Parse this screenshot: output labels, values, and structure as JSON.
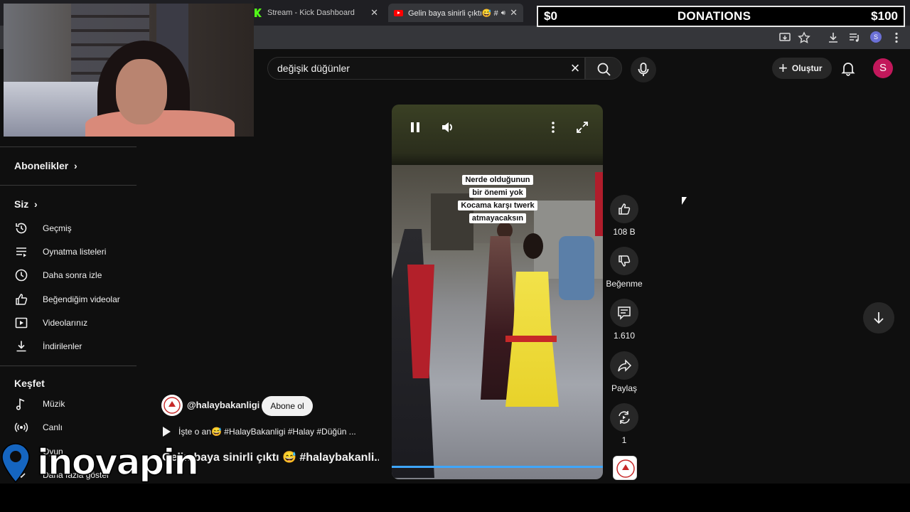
{
  "browser": {
    "tabs": [
      {
        "title": "Stream - Kick Dashboard",
        "icon": "kick-icon",
        "close": "✕"
      },
      {
        "title": "Gelin baya sinirli çıktı😅 #h",
        "icon": "youtube-icon",
        "close": "✕"
      }
    ]
  },
  "overlay": {
    "donations_left": "$0",
    "donations_label": "DONATIONS",
    "donations_right": "$100"
  },
  "header": {
    "search_value": "değişik düğünler",
    "create_label": "Oluştur",
    "avatar_letter": "S"
  },
  "sidebar": {
    "subscriptions_label": "Abonelikler",
    "you_label": "Siz",
    "you_items": [
      {
        "label": "Geçmiş",
        "icon": "history-icon"
      },
      {
        "label": "Oynatma listeleri",
        "icon": "playlist-icon"
      },
      {
        "label": "Daha sonra izle",
        "icon": "clock-icon"
      },
      {
        "label": "Beğendiğim videolar",
        "icon": "thumb-up-icon"
      },
      {
        "label": "Videolarınız",
        "icon": "video-icon"
      },
      {
        "label": "İndirilenler",
        "icon": "download-icon"
      }
    ],
    "explore_label": "Keşfet",
    "explore_items": [
      {
        "label": "Müzik",
        "icon": "music-note-icon"
      },
      {
        "label": "Canlı",
        "icon": "live-icon"
      },
      {
        "label": "Oyun",
        "icon": "gamepad-icon"
      }
    ],
    "show_more_label": "Daha fazla göster"
  },
  "video": {
    "caption_lines": [
      "Nerde olduğunun",
      "bir önemi yok",
      "Kocama karşı twerk",
      "atmayacaksın"
    ],
    "likes": "108 B",
    "dislike_label": "Beğenme",
    "comments": "1.610",
    "share_label": "Paylaş",
    "remix_count": "1",
    "channel_handle": "@halaybakanligi",
    "subscribe_label": "Abone ol",
    "description_line": "İşte o an😅 #HalayBakanligi #Halay #Düğün ...",
    "title": "Gelin baya sinirli çıktı 😅 #halaybakanli..."
  },
  "watermark": {
    "text": "inovapin"
  }
}
